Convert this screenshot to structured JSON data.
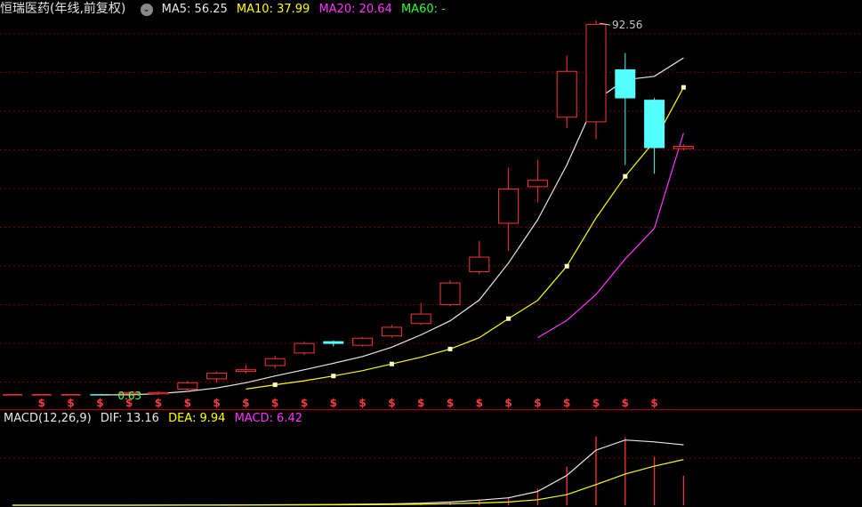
{
  "header": {
    "title": "恒瑞医药(年线,前复权)",
    "toggle_glyph": "⌄",
    "ma5": "MA5: 56.25",
    "ma10": "MA10: 37.99",
    "ma20": "MA20: 20.64",
    "ma60": "MA60: -"
  },
  "macd_header": {
    "label": "MACD(12,26,9)",
    "dif": "DIF: 13.16",
    "dea": "DEA: 9.94",
    "macd": "MACD: 6.42"
  },
  "colors": {
    "up": "#ff3232",
    "down": "#54ffff",
    "ma5": "#e8e8e8",
    "ma10": "#ffff00",
    "ma20": "#ff33ff",
    "grid": "#7a0000"
  },
  "annotations": {
    "high": "92.56",
    "low": "0.63",
    "marker_symbol": "$"
  },
  "chart_data": {
    "type": "candlestick",
    "y_scale": "log",
    "x_labels": [],
    "candles": [
      {
        "o": 0.63,
        "h": 0.63,
        "l": 0.63,
        "c": 0.63
      },
      {
        "o": 0.63,
        "h": 0.63,
        "l": 0.63,
        "c": 0.63
      },
      {
        "o": 0.63,
        "h": 0.63,
        "l": 0.63,
        "c": 0.63
      },
      {
        "o": 0.63,
        "h": 0.63,
        "l": 0.63,
        "c": 0.63
      },
      {
        "o": 0.64,
        "h": 0.66,
        "l": 0.63,
        "c": 0.65
      },
      {
        "o": 0.64,
        "h": 0.66,
        "l": 0.63,
        "c": 0.65
      },
      {
        "o": 0.68,
        "h": 0.76,
        "l": 0.66,
        "c": 0.74
      },
      {
        "o": 0.78,
        "h": 0.86,
        "l": 0.74,
        "c": 0.84
      },
      {
        "o": 0.86,
        "h": 0.94,
        "l": 0.84,
        "c": 0.88
      },
      {
        "o": 0.93,
        "h": 1.06,
        "l": 0.9,
        "c": 1.02
      },
      {
        "o": 1.1,
        "h": 1.28,
        "l": 1.07,
        "c": 1.25
      },
      {
        "o": 1.28,
        "h": 1.3,
        "l": 1.2,
        "c": 1.25
      },
      {
        "o": 1.22,
        "h": 1.36,
        "l": 1.2,
        "c": 1.34
      },
      {
        "o": 1.38,
        "h": 1.6,
        "l": 1.35,
        "c": 1.55
      },
      {
        "o": 1.63,
        "h": 2.15,
        "l": 1.6,
        "c": 1.85
      },
      {
        "o": 2.1,
        "h": 2.9,
        "l": 2.05,
        "c": 2.8
      },
      {
        "o": 3.25,
        "h": 4.9,
        "l": 3.15,
        "c": 3.95
      },
      {
        "o": 6.2,
        "h": 13.0,
        "l": 4.3,
        "c": 9.8
      },
      {
        "o": 10.1,
        "h": 14.5,
        "l": 8.2,
        "c": 11.0
      },
      {
        "o": 25.5,
        "h": 58.0,
        "l": 22.0,
        "c": 47.0
      },
      {
        "o": 24.0,
        "h": 92.56,
        "l": 19.0,
        "c": 88.0
      },
      {
        "o": 48.0,
        "h": 60.0,
        "l": 13.5,
        "c": 33.0
      },
      {
        "o": 32.0,
        "h": 33.0,
        "l": 12.0,
        "c": 17.0
      },
      {
        "o": 16.8,
        "h": 17.8,
        "l": 16.4,
        "c": 17.3
      }
    ],
    "ma5": [
      null,
      null,
      null,
      null,
      0.63,
      0.63,
      0.64,
      0.66,
      0.69,
      0.74,
      0.81,
      0.88,
      0.96,
      1.05,
      1.19,
      1.4,
      1.69,
      2.23,
      3.65,
      6.5,
      13.5,
      32.0,
      42.0,
      44.0,
      56.25
    ],
    "ma10": [
      null,
      null,
      null,
      null,
      null,
      null,
      null,
      null,
      null,
      0.68,
      0.72,
      0.76,
      0.81,
      0.87,
      0.95,
      1.04,
      1.16,
      1.35,
      1.74,
      2.22,
      3.5,
      6.65,
      11.6,
      18.5,
      37.99
    ],
    "ma20": [
      null,
      null,
      null,
      null,
      null,
      null,
      null,
      null,
      null,
      null,
      null,
      null,
      null,
      null,
      null,
      null,
      null,
      null,
      null,
      1.35,
      1.7,
      2.4,
      3.85,
      5.8,
      20.64
    ],
    "macd": {
      "dif": [
        0,
        0,
        0,
        0,
        0,
        0,
        0.01,
        0.02,
        0.04,
        0.06,
        0.09,
        0.12,
        0.16,
        0.22,
        0.3,
        0.45,
        0.7,
        1.1,
        1.6,
        3.0,
        6.5,
        12.0,
        14.2,
        13.8,
        13.16
      ],
      "dea": [
        0,
        0,
        0,
        0,
        0,
        0,
        0,
        0.01,
        0.02,
        0.03,
        0.05,
        0.07,
        0.09,
        0.12,
        0.16,
        0.22,
        0.32,
        0.48,
        0.7,
        1.2,
        2.3,
        4.5,
        6.8,
        8.5,
        9.94
      ],
      "hist": [
        0,
        0,
        0,
        0,
        0,
        0,
        0.01,
        0.02,
        0.04,
        0.06,
        0.08,
        0.1,
        0.14,
        0.2,
        0.28,
        0.46,
        0.76,
        1.24,
        1.8,
        3.6,
        8.4,
        15.0,
        14.8,
        10.6,
        6.42
      ]
    }
  }
}
